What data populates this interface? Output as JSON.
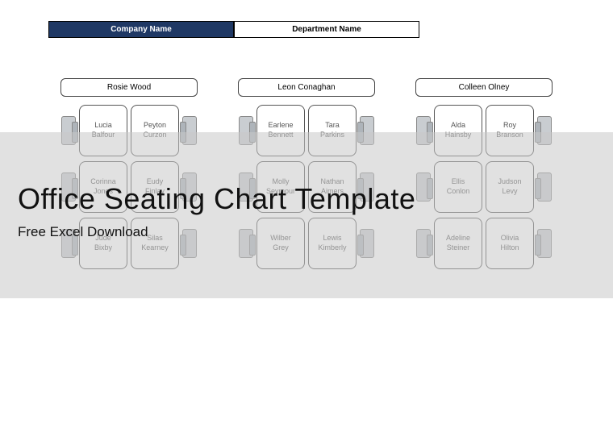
{
  "header": {
    "company": "Company Name",
    "department": "Department Name"
  },
  "overlay": {
    "title": "Office Seating Chart Template",
    "subtitle": "Free Excel Download"
  },
  "clusters": [
    {
      "lead": "Rosie Wood",
      "rows": [
        [
          {
            "f": "Lucia",
            "l": "Balfour"
          },
          {
            "f": "Peyton",
            "l": "Curzon"
          }
        ],
        [
          {
            "f": "Corinna",
            "l": "Jones"
          },
          {
            "f": "Eudy",
            "l": "Finlay"
          }
        ],
        [
          {
            "f": "Jude",
            "l": "Bixby"
          },
          {
            "f": "Silas",
            "l": "Kearney"
          }
        ]
      ]
    },
    {
      "lead": "Leon Conaghan",
      "rows": [
        [
          {
            "f": "Earlene",
            "l": "Bennett"
          },
          {
            "f": "Tara",
            "l": "Parkins"
          }
        ],
        [
          {
            "f": "Molly",
            "l": "Seymour"
          },
          {
            "f": "Nathan",
            "l": "Aimers"
          }
        ],
        [
          {
            "f": "Wilber",
            "l": "Grey"
          },
          {
            "f": "Lewis",
            "l": "Kimberly"
          }
        ]
      ]
    },
    {
      "lead": "Colleen Olney",
      "rows": [
        [
          {
            "f": "Alda",
            "l": "Hainsby"
          },
          {
            "f": "Roy",
            "l": "Branson"
          }
        ],
        [
          {
            "f": "Ellis",
            "l": "Conlon"
          },
          {
            "f": "Judson",
            "l": "Levy"
          }
        ],
        [
          {
            "f": "Adeline",
            "l": "Steiner"
          },
          {
            "f": "Olivia",
            "l": "Hilton"
          }
        ]
      ]
    }
  ]
}
